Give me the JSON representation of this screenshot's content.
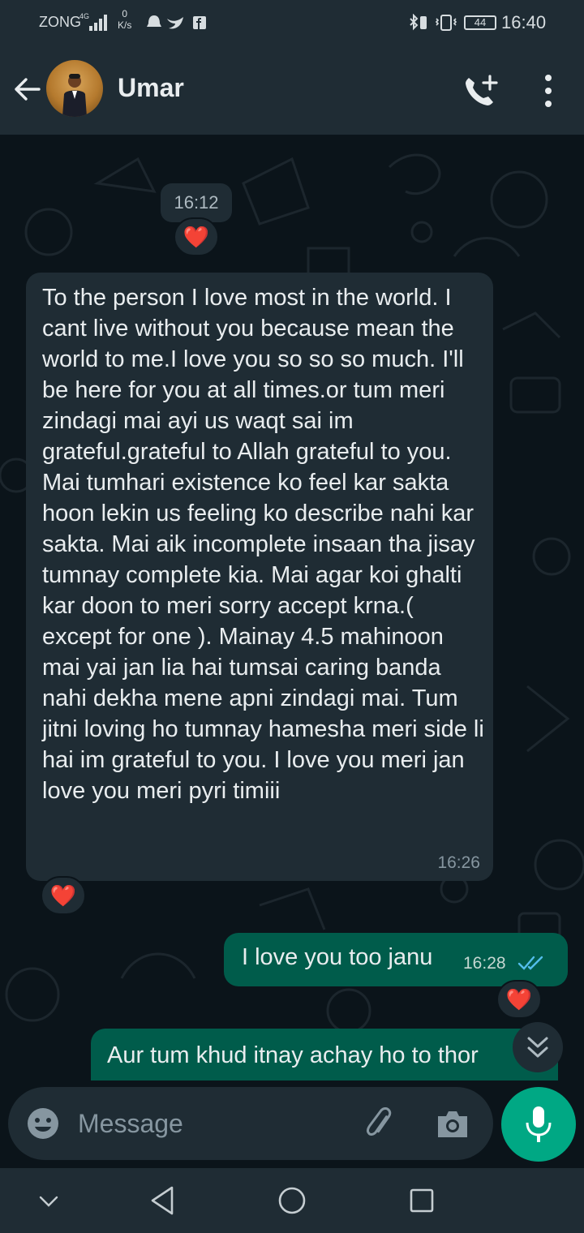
{
  "status_bar": {
    "carrier": "ZONG",
    "network_sup": "4G",
    "speed_value": "0",
    "speed_unit": "K/s",
    "battery": "44",
    "time": "16:40"
  },
  "header": {
    "contact_name": "Umar"
  },
  "chat": {
    "date_chip_time": "16:12",
    "reaction_emoji": "❤️",
    "incoming_message": "To the person I love most in the world. I cant live without you because mean the world to me.I love you so so so much. I'll be here for you at all times.or tum meri zindagi mai ayi us waqt sai im grateful.grateful to Allah grateful to you. Mai tumhari existence ko feel kar sakta hoon lekin us feeling ko describe nahi kar sakta. Mai aik incomplete insaan tha jisay tumnay complete kia. Mai agar koi ghalti kar doon to meri sorry accept krna.( except for one ). Mainay 4.5 mahinoon mai yai jan lia hai tumsai caring banda nahi dekha mene apni zindagi mai. Tum jitni loving ho tumnay hamesha meri side li hai im grateful to you. I love you meri jan love you meri pyri timiii",
    "incoming_time": "16:26",
    "outgoing_message": "I love you too janu",
    "outgoing_time": "16:28",
    "outgoing_partial": "Aur tum khud itnay achay ho to thor"
  },
  "composer": {
    "placeholder": "Message"
  },
  "colors": {
    "header_bg": "#1f2c34",
    "chat_bg": "#0b141a",
    "incoming_bubble": "#1f2c34",
    "outgoing_bubble": "#005c4b",
    "accent": "#00a884",
    "read_ticks": "#53bdeb"
  },
  "icons": [
    "back-arrow-icon",
    "add-call-icon",
    "more-options-icon",
    "emoji-icon",
    "attach-icon",
    "camera-icon",
    "mic-icon",
    "double-chevron-down-icon",
    "nav-back-icon",
    "nav-home-icon",
    "nav-recents-icon",
    "nav-hide-icon"
  ]
}
